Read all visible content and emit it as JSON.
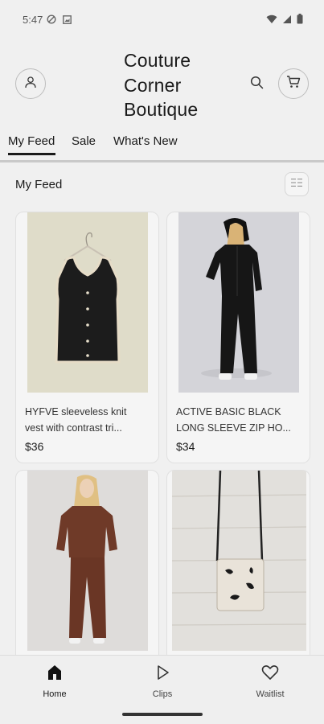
{
  "status_bar": {
    "time": "5:47",
    "left_icons": [
      "blocked-notification-icon",
      "screenshot-icon"
    ],
    "right_icons": [
      "wifi-icon",
      "cell-signal-icon",
      "battery-icon"
    ]
  },
  "header": {
    "brand_lines": [
      "Couture",
      "Corner",
      "Boutique"
    ],
    "icons": [
      "profile-icon",
      "search-icon",
      "cart-icon"
    ]
  },
  "tabs": [
    {
      "label": "My Feed",
      "active": true
    },
    {
      "label": "Sale",
      "active": false
    },
    {
      "label": "What's New",
      "active": false
    }
  ],
  "feed": {
    "title": "My Feed",
    "view_toggle_icon": "grid-view-icon"
  },
  "products": [
    {
      "name": "HYFVE sleeveless knit vest with contrast tri...",
      "price": "$36",
      "image": "black-knit-vest"
    },
    {
      "name": "ACTIVE BASIC BLACK LONG SLEEVE ZIP HO...",
      "price": "$34",
      "image": "black-zip-hoodie-set"
    },
    {
      "name": "",
      "price": "",
      "image": "brown-lounge-set"
    },
    {
      "name": "",
      "price": "",
      "image": "cowhide-crossbody-bag"
    }
  ],
  "bottom_nav": [
    {
      "label": "Home",
      "icon": "home-icon",
      "active": true
    },
    {
      "label": "Clips",
      "icon": "play-icon",
      "active": false
    },
    {
      "label": "Waitlist",
      "icon": "heart-icon",
      "active": false
    }
  ],
  "colors": {
    "background": "#f0f0f0",
    "text": "#1a1a1a",
    "card": "#f5f5f5",
    "accent": "#1a1a1a"
  }
}
